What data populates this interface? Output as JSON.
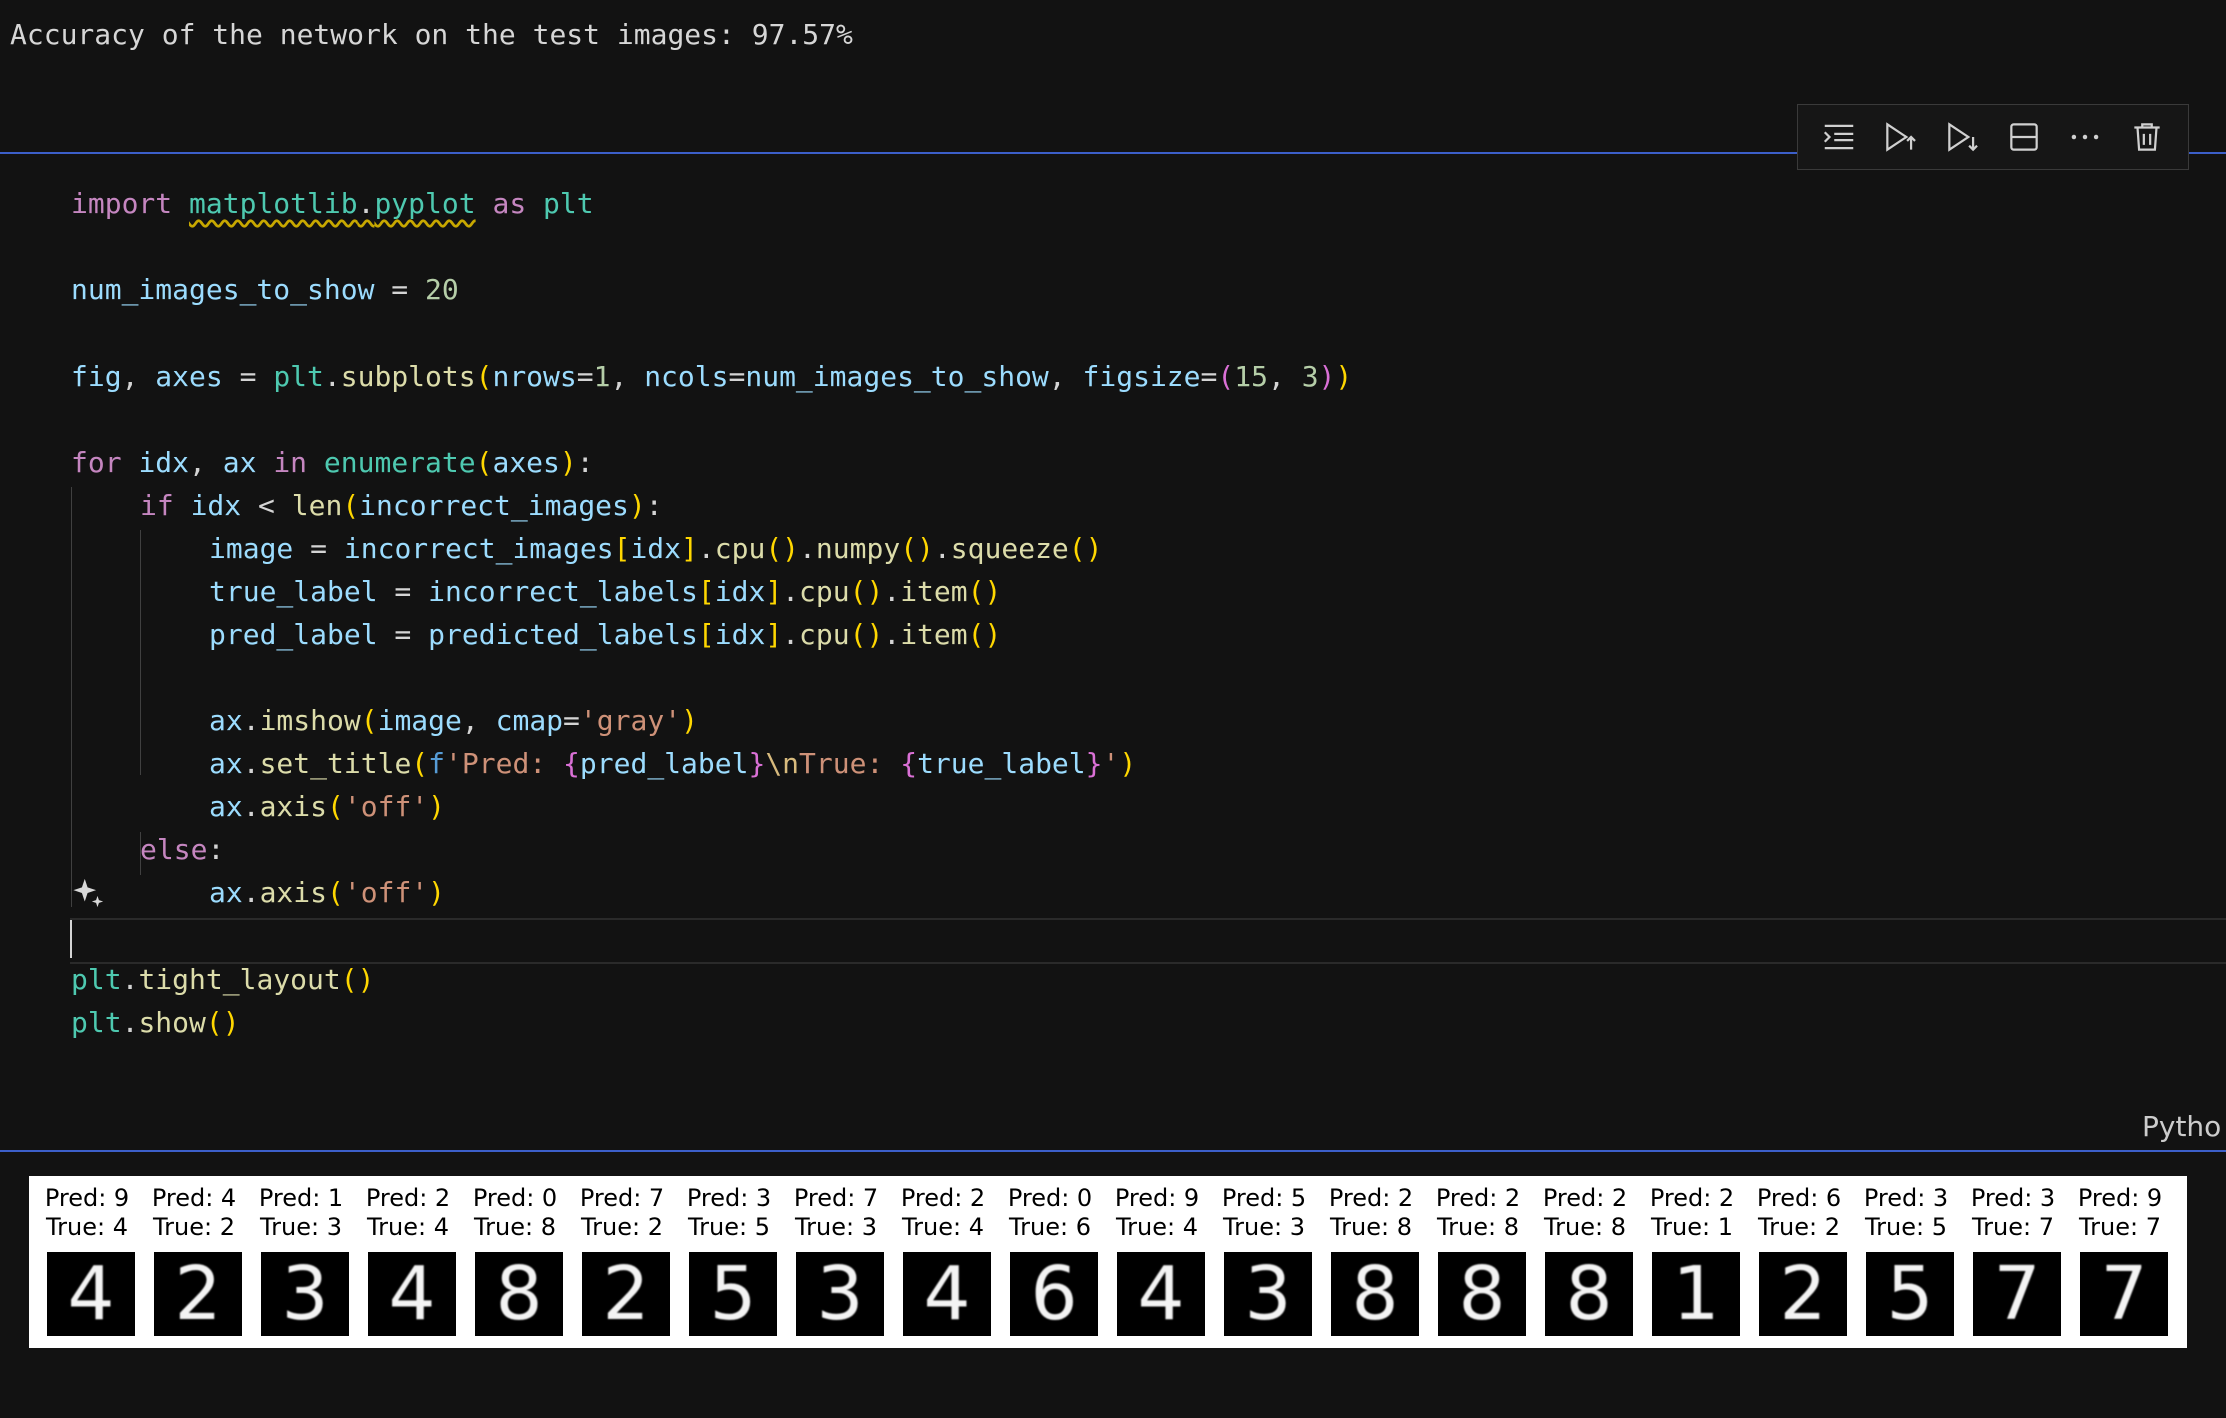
{
  "previous_output": "Accuracy of the network on the test images: 97.57%",
  "toolbar": {
    "icons": [
      "execute-above-icon",
      "run-above-icon",
      "run-below-icon",
      "split-cell-icon",
      "more-icon",
      "trash-icon"
    ]
  },
  "code": {
    "l1": {
      "k1": "import",
      "mod": "matplotlib",
      "dot": ".",
      "sub": "pyplot",
      "k2": " as ",
      "alias": "plt"
    },
    "l2": {
      "var": "num_images_to_show",
      "eq": " = ",
      "num": "20"
    },
    "l3": {
      "a": "fig",
      "c1": ", ",
      "b": "axes",
      "eq": " = ",
      "plt": "plt",
      "dot": ".",
      "fn": "subplots",
      "p_open": "(",
      "kw1": "nrows",
      "e1": "=",
      "n1": "1",
      "c2": ", ",
      "kw2": "ncols",
      "e2": "=",
      "v2": "num_images_to_show",
      "c3": ", ",
      "kw3": "figsize",
      "e3": "=",
      "t_open": "(",
      "n2": "15",
      "c4": ", ",
      "n3": "3",
      "t_close": ")",
      "p_close": ")"
    },
    "l4": {
      "for": "for",
      "sp1": " ",
      "idx": "idx",
      "c": ", ",
      "ax": "ax",
      "sp2": " ",
      "in": "in",
      "sp3": " ",
      "fn": "enumerate",
      "po": "(",
      "axes": "axes",
      "pc": ")",
      "colon": ":"
    },
    "l5": {
      "if": "if",
      "sp": " ",
      "idx": "idx",
      "lt": " < ",
      "fn": "len",
      "po": "(",
      "arg": "incorrect_images",
      "pc": ")",
      "colon": ":"
    },
    "l6": {
      "var": "image",
      "eq": " = ",
      "arr": "incorrect_images",
      "bo": "[",
      "idx": "idx",
      "bc": "]",
      "d1": ".",
      "f1": "cpu",
      "pp1": "()",
      "d2": ".",
      "f2": "numpy",
      "pp2": "()",
      "d3": ".",
      "f3": "squeeze",
      "pp3": "()"
    },
    "l7": {
      "var": "true_label",
      "eq": " = ",
      "arr": "incorrect_labels",
      "bo": "[",
      "idx": "idx",
      "bc": "]",
      "d1": ".",
      "f1": "cpu",
      "pp1": "()",
      "d2": ".",
      "f2": "item",
      "pp2": "()"
    },
    "l8": {
      "var": "pred_label",
      "eq": " = ",
      "arr": "predicted_labels",
      "bo": "[",
      "idx": "idx",
      "bc": "]",
      "d1": ".",
      "f1": "cpu",
      "pp1": "()",
      "d2": ".",
      "f2": "item",
      "pp2": "()"
    },
    "l9": {
      "obj": "ax",
      "d": ".",
      "fn": "imshow",
      "po": "(",
      "arg": "image",
      "c": ", ",
      "kw": "cmap",
      "e": "=",
      "str": "'gray'",
      "pc": ")"
    },
    "l10": {
      "obj": "ax",
      "d": ".",
      "fn": "set_title",
      "po": "(",
      "f": "f",
      "s1": "'Pred: ",
      "bo1": "{",
      "v1": "pred_label",
      "bc1": "}",
      "esc": "\\n",
      "s2": "True: ",
      "bo2": "{",
      "v2": "true_label",
      "bc2": "}",
      "s3": "'",
      "pc": ")"
    },
    "l11": {
      "obj": "ax",
      "d": ".",
      "fn": "axis",
      "po": "(",
      "str": "'off'",
      "pc": ")"
    },
    "l12": {
      "else": "else",
      "colon": ":"
    },
    "l13": {
      "obj": "ax",
      "d": ".",
      "fn": "axis",
      "po": "(",
      "str": "'off'",
      "pc": ")"
    },
    "l14": {
      "plt": "plt",
      "d": ".",
      "fn": "tight_layout",
      "pp": "()"
    },
    "l15": {
      "plt": "plt",
      "d": ".",
      "fn": "show",
      "pp": "()"
    }
  },
  "language_label": "Pytho",
  "figure": {
    "panels": [
      {
        "pred": "Pred: 9",
        "true": "True: 4",
        "digit": "4"
      },
      {
        "pred": "Pred: 4",
        "true": "True: 2",
        "digit": "2"
      },
      {
        "pred": "Pred: 1",
        "true": "True: 3",
        "digit": "3"
      },
      {
        "pred": "Pred: 2",
        "true": "True: 4",
        "digit": "4"
      },
      {
        "pred": "Pred: 0",
        "true": "True: 8",
        "digit": "8"
      },
      {
        "pred": "Pred: 7",
        "true": "True: 2",
        "digit": "2"
      },
      {
        "pred": "Pred: 3",
        "true": "True: 5",
        "digit": "5"
      },
      {
        "pred": "Pred: 7",
        "true": "True: 3",
        "digit": "3"
      },
      {
        "pred": "Pred: 2",
        "true": "True: 4",
        "digit": "4"
      },
      {
        "pred": "Pred: 0",
        "true": "True: 6",
        "digit": "6"
      },
      {
        "pred": "Pred: 9",
        "true": "True: 4",
        "digit": "4"
      },
      {
        "pred": "Pred: 5",
        "true": "True: 3",
        "digit": "3"
      },
      {
        "pred": "Pred: 2",
        "true": "True: 8",
        "digit": "8"
      },
      {
        "pred": "Pred: 2",
        "true": "True: 8",
        "digit": "8"
      },
      {
        "pred": "Pred: 2",
        "true": "True: 8",
        "digit": "8"
      },
      {
        "pred": "Pred: 2",
        "true": "True: 1",
        "digit": "1"
      },
      {
        "pred": "Pred: 6",
        "true": "True: 2",
        "digit": "2"
      },
      {
        "pred": "Pred: 3",
        "true": "True: 5",
        "digit": "5"
      },
      {
        "pred": "Pred: 3",
        "true": "True: 7",
        "digit": "7"
      },
      {
        "pred": "Pred: 9",
        "true": "True: 7",
        "digit": "7"
      }
    ]
  },
  "colors": {
    "accent_border": "#3c5fc9",
    "background": "#121212"
  }
}
